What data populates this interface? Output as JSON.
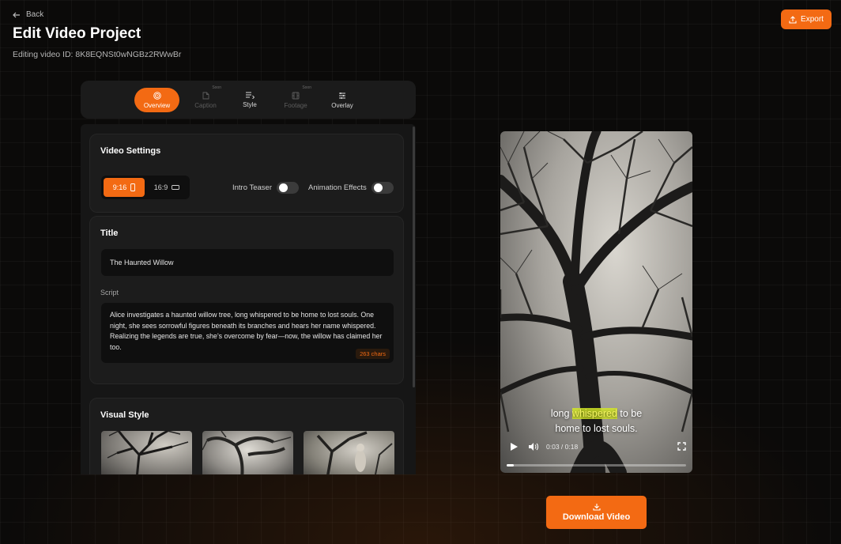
{
  "header": {
    "back_label": "Back",
    "title": "Edit Video Project",
    "subtitle": "Editing video ID: 8K8EQNSt0wNGBz2RWwBr",
    "export_label": "Export"
  },
  "tabs": [
    {
      "label": "Overview",
      "icon": "target-icon",
      "state": "active"
    },
    {
      "label": "Caption",
      "icon": "file-icon",
      "state": "disabled",
      "badge": "Soon"
    },
    {
      "label": "Style",
      "icon": "list-icon",
      "state": "normal"
    },
    {
      "label": "Footage",
      "icon": "film-icon",
      "state": "disabled",
      "badge": "Soon"
    },
    {
      "label": "Overlay",
      "icon": "sliders-icon",
      "state": "normal"
    }
  ],
  "video_settings": {
    "title": "Video Settings",
    "aspect_options": [
      {
        "label": "9:16",
        "icon": "portrait-icon",
        "selected": true
      },
      {
        "label": "16:9",
        "icon": "landscape-icon",
        "selected": false
      }
    ],
    "toggles": [
      {
        "label": "Intro Teaser",
        "on": false
      },
      {
        "label": "Animation Effects",
        "on": false
      }
    ]
  },
  "title_section": {
    "heading": "Title",
    "title_value": "The Haunted Willow",
    "script_label": "Script",
    "script_value": "Alice investigates a haunted willow tree, long whispered to be home to lost souls. One night, she sees sorrowful figures beneath its branches and hears her name whispered. Realizing the legends are true, she's overcome by fear—now, the willow has claimed her too.",
    "char_count": "263 chars"
  },
  "visual_style": {
    "heading": "Visual Style",
    "thumbnails": [
      "thumbnail-1",
      "thumbnail-2",
      "thumbnail-3"
    ]
  },
  "player": {
    "caption_before": "long ",
    "caption_highlight": "whispered",
    "caption_after": " to be",
    "caption_line2": "home to lost souls.",
    "time": "0:03 / 0:18",
    "progress": 0.04
  },
  "download_label": "Download Video",
  "colors": {
    "accent": "#f36a13",
    "background": "#0b0a09",
    "panel": "#161616",
    "caption_highlight": "#f5f560"
  }
}
